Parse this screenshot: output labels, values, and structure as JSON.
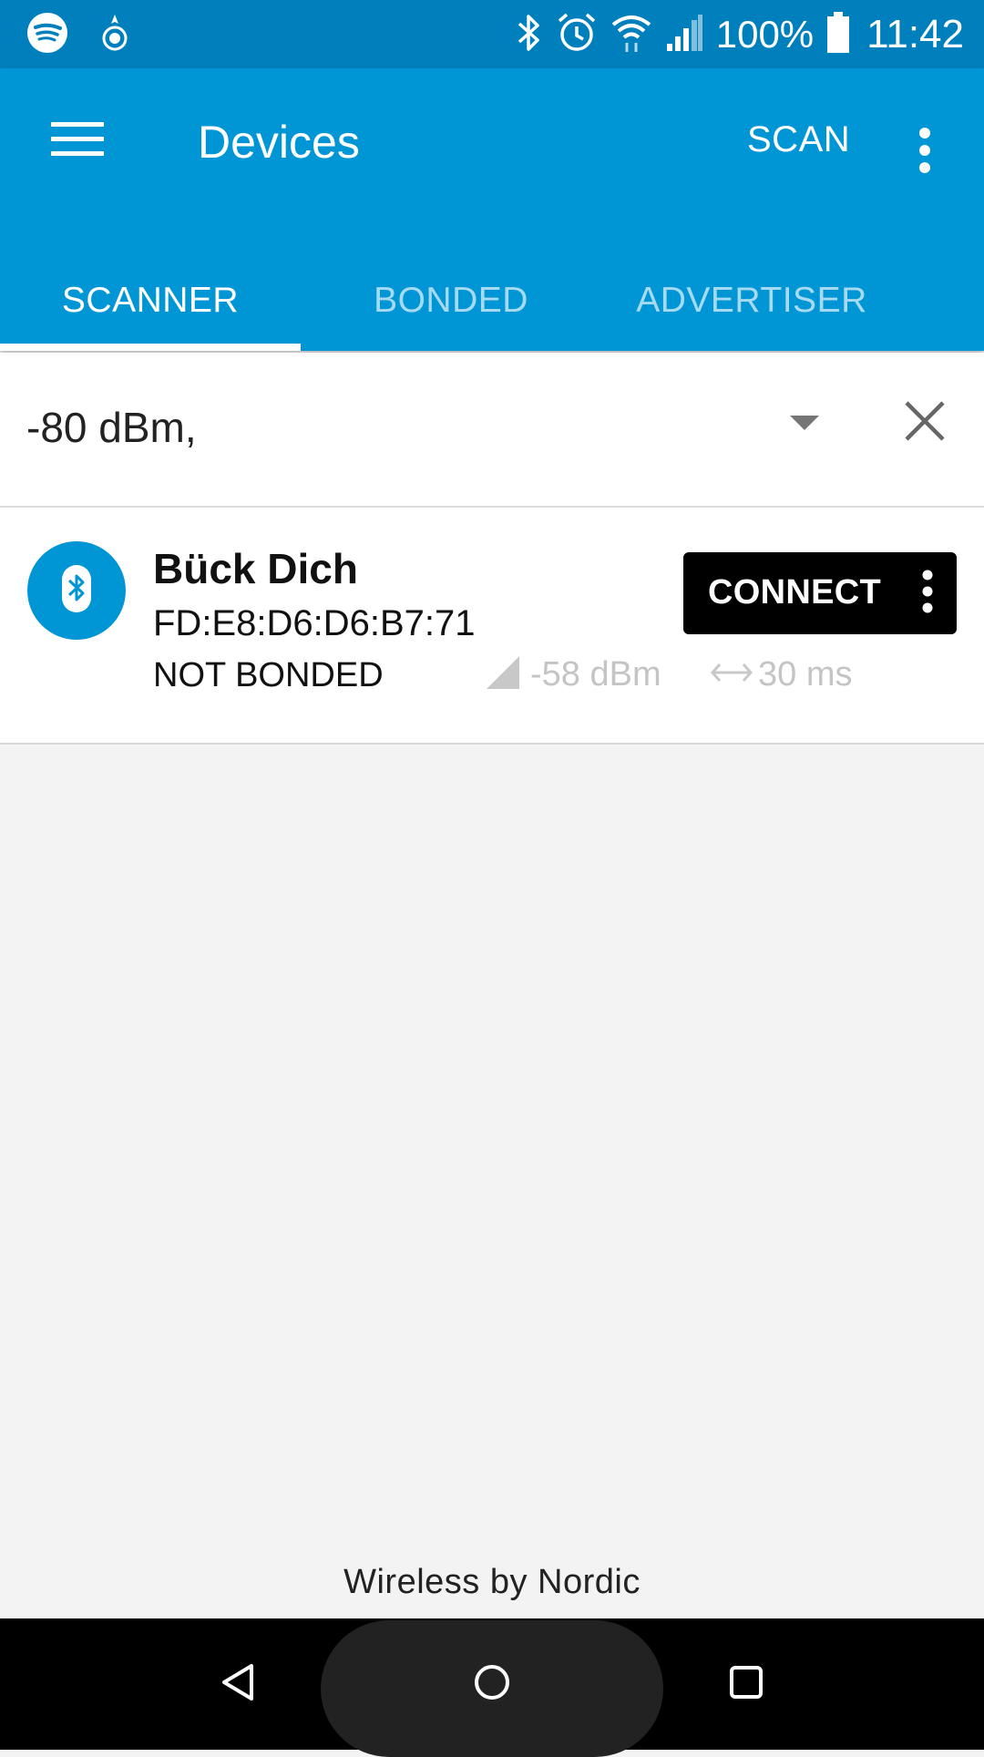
{
  "status_bar": {
    "battery": "100%",
    "time": "11:42",
    "left_icons": [
      "spotify-icon",
      "app-notification-icon"
    ],
    "right_icons": [
      "bluetooth-icon",
      "alarm-icon",
      "wifi-icon",
      "cellular-signal-icon",
      "battery-icon"
    ]
  },
  "app_bar": {
    "title": "Devices",
    "scan_label": "SCAN",
    "color": "#0096d6"
  },
  "tabs": [
    {
      "label": "SCANNER",
      "active": true
    },
    {
      "label": "BONDED",
      "active": false
    },
    {
      "label": "ADVERTISER",
      "active": false
    }
  ],
  "filter": {
    "value": "-80 dBm,"
  },
  "devices": [
    {
      "name": "Bück Dich",
      "address": "FD:E8:D6:D6:B7:71",
      "bond_state": "NOT BONDED",
      "rssi": "-58 dBm",
      "interval": "30 ms",
      "action_label": "CONNECT"
    }
  ],
  "footer": {
    "text": "Wireless by Nordic"
  }
}
